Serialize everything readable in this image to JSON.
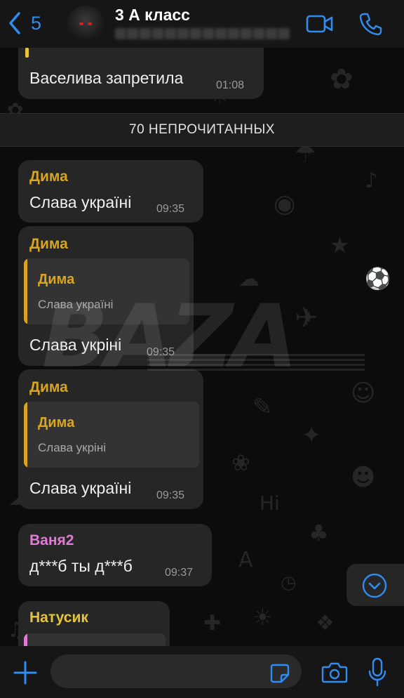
{
  "header": {
    "back_count": "5",
    "title": "3 А класс"
  },
  "messages": [
    {
      "text": "Васелива запретила",
      "time": "01:08"
    },
    {
      "sender": "Дима",
      "text": "Слава україні",
      "time": "09:35"
    },
    {
      "sender": "Дима",
      "quote_sender": "Дима",
      "quote_text": "Слава україні",
      "text": "Слава укріні",
      "time": "09:35"
    },
    {
      "sender": "Дима",
      "quote_sender": "Дима",
      "quote_text": "Слава укріні",
      "text": "Слава україні",
      "time": "09:35"
    },
    {
      "sender": "Ваня2",
      "text": "д***б ты д***б",
      "time": "09:37"
    },
    {
      "sender": "Натусик"
    }
  ],
  "unread_banner": "70 НЕПРОЧИТАННЫХ",
  "watermark": "BAZA",
  "composer": {
    "value": ""
  },
  "colors": {
    "accent": "#2f8cf0",
    "sender_dima": "#d9a520",
    "sender_vanya": "#e07ad4",
    "sender_natusik": "#e8c43a",
    "quote_bar_natusik": "#e07ad4",
    "bubble": "#262626"
  },
  "icons": {
    "back": "chevron-left-icon",
    "video": "video-camera-icon",
    "call": "phone-icon",
    "scroll_down": "chevron-down-circle-icon",
    "plus": "plus-icon",
    "sticker": "sticker-icon",
    "camera": "camera-icon",
    "mic": "microphone-icon"
  }
}
